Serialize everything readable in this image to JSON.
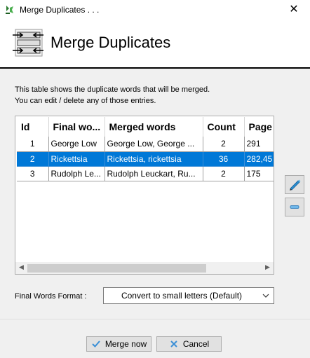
{
  "window": {
    "title": "Merge Duplicates . . .",
    "close_glyph": "✕"
  },
  "header": {
    "title": "Merge Duplicates"
  },
  "description": {
    "line1": "This table shows the duplicate words that will be merged.",
    "line2": "You can edit / delete any of those entries."
  },
  "table": {
    "columns": [
      "Id",
      "Final wo...",
      "Merged words",
      "Count",
      "Page"
    ],
    "rows": [
      {
        "id": "1",
        "final": "George Low",
        "merged": "George Low, George ...",
        "count": "2",
        "page": "291",
        "selected": false
      },
      {
        "id": "2",
        "final": "Rickettsia",
        "merged": "Rickettsia, rickettsia",
        "count": "36",
        "page": "282,45",
        "selected": true
      },
      {
        "id": "3",
        "final": "Rudolph Le...",
        "merged": "Rudolph Leuckart, Ru...",
        "count": "2",
        "page": "175",
        "selected": false
      }
    ]
  },
  "side_buttons": {
    "edit_icon": "pencil-icon",
    "delete_icon": "minus-icon"
  },
  "format": {
    "label": "Final Words Format :",
    "value": "Convert to small letters (Default)"
  },
  "buttons": {
    "merge": "Merge now",
    "cancel": "Cancel"
  },
  "colors": {
    "selection": "#0078d7",
    "dialog_bg": "#f0f0f0"
  }
}
